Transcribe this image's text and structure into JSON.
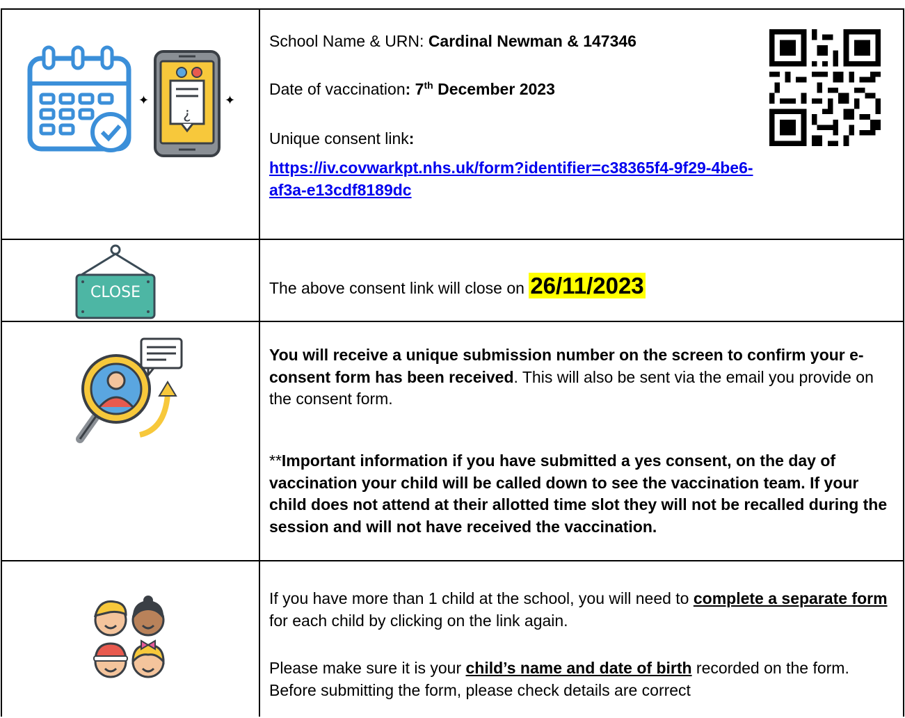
{
  "row1": {
    "school_label": "School Name & URN: ",
    "school_value": "Cardinal Newman & 147346",
    "date_label": "Date of vaccination",
    "date_colon": ": 7",
    "date_sup": "th",
    "date_rest": " December 2023",
    "link_label": "Unique consent link",
    "link_colon": ":",
    "link_line1": "https://iv.covwarkpt.nhs.uk/form?identifier=c38365f4-9f29-4be6-",
    "link_line2": "af3a-e13cdf8189dc"
  },
  "row2": {
    "close_sign": "CLOSE",
    "text": "The above consent link will close on ",
    "close_date": "26/11/2023"
  },
  "row3": {
    "bold1": "You will receive a unique submission number on the screen to confirm your e-consent form has been received",
    "rest1": ". This will also be sent via the email you provide on the consent form.",
    "stars": "**",
    "bold2": "Important information if you have submitted a yes consent, on the day of vaccination your child will be called down to see the vaccination team.  If your child does not attend at their allotted time slot they will not be recalled during the session and will not have received the vaccination."
  },
  "row4": {
    "p1_a": "If you have more than 1 child at the school, you will need to ",
    "p1_u": "complete a separate form",
    "p1_b": " for each child by clicking on the link again.",
    "p2_a": "Please make sure it is your ",
    "p2_u": "child’s name and date of birth",
    "p2_b": " recorded on the form. Before submitting the form, please check details are correct"
  },
  "colors": {
    "link": "#0000ee",
    "highlight": "#ffff00",
    "calendar": "#3b8fd9",
    "sign": "#4db6a4"
  }
}
